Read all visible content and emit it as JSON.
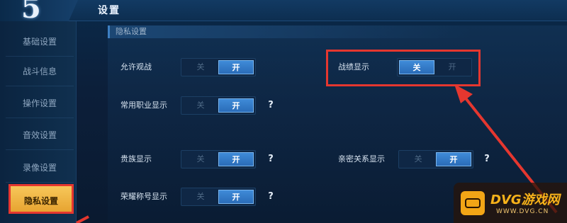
{
  "header": {
    "title": "设置"
  },
  "sidebar": {
    "items": [
      {
        "label": "基础设置",
        "active": false
      },
      {
        "label": "战斗信息",
        "active": false
      },
      {
        "label": "操作设置",
        "active": false
      },
      {
        "label": "音效设置",
        "active": false
      },
      {
        "label": "录像设置",
        "active": false
      },
      {
        "label": "隐私设置",
        "active": true
      }
    ]
  },
  "section": {
    "title": "隐私设置"
  },
  "toggles": {
    "off_label": "关",
    "on_label": "开",
    "allow_spectate": {
      "label": "允许观战",
      "state": "on"
    },
    "record_display": {
      "label": "战绩显示",
      "state": "off"
    },
    "common_role_display": {
      "label": "常用职业显示",
      "state": "on"
    },
    "noble_display": {
      "label": "贵族显示",
      "state": "on"
    },
    "intimacy_display": {
      "label": "亲密关系显示",
      "state": "on"
    },
    "honor_title_display": {
      "label": "荣耀称号显示",
      "state": "on"
    }
  },
  "help_glyph": "?",
  "watermark": {
    "title": "DVG游戏网",
    "url": "WWW.DVG.CN"
  },
  "colors": {
    "highlight": "#e5372f",
    "toggle_on": "#2a6cb8",
    "sidebar_active": "#f7c75a"
  }
}
